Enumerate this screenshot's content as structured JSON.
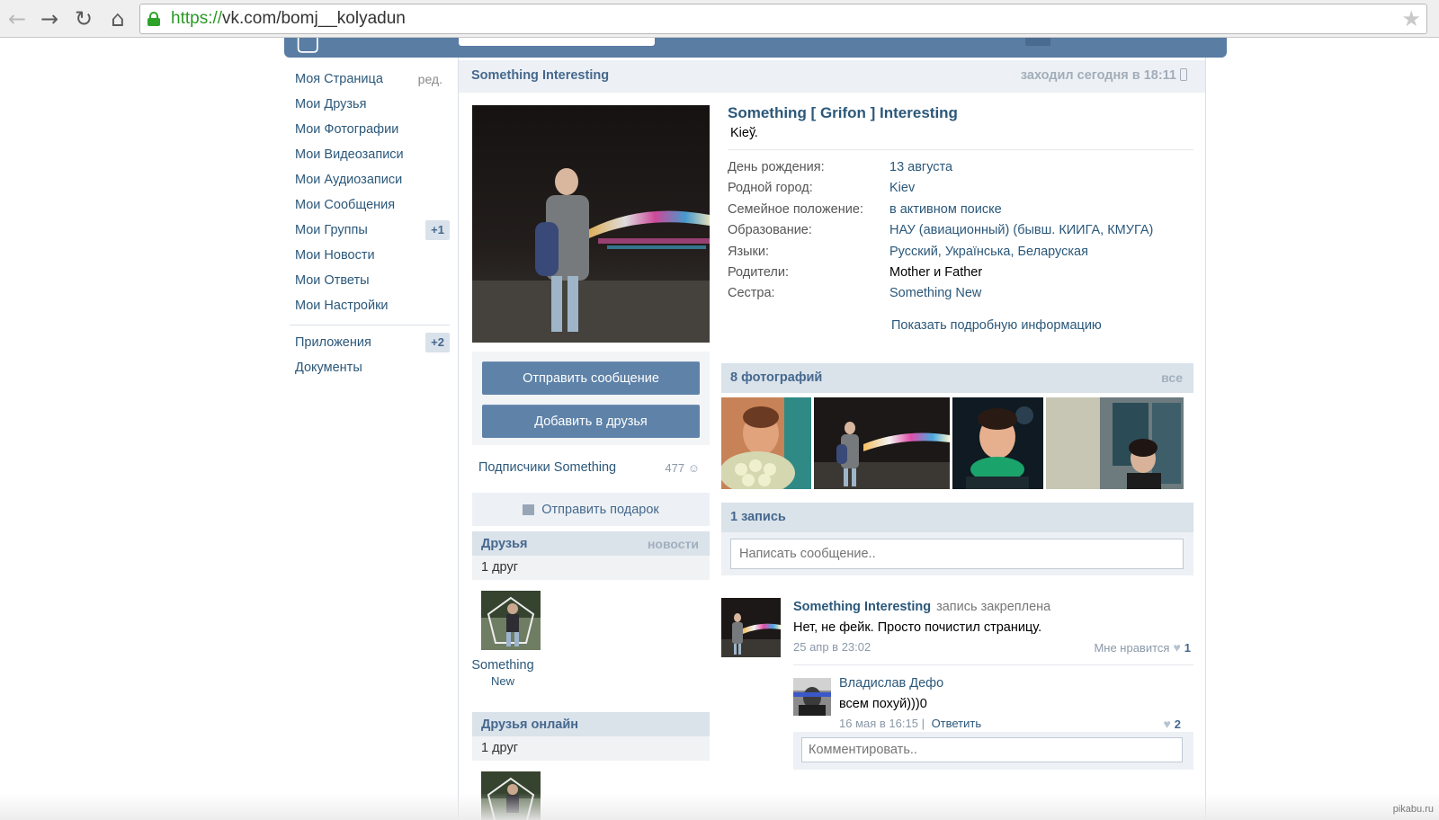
{
  "browser": {
    "url_scheme": "https://",
    "url_rest": "vk.com/bomj__kolyadun",
    "icons": [
      "back-arrow-icon",
      "forward-arrow-icon",
      "reload-icon",
      "home-icon",
      "lock-icon",
      "star-icon"
    ]
  },
  "sidebar": {
    "edit_label": "ред.",
    "items": [
      {
        "label": "Моя Страница"
      },
      {
        "label": "Мои Друзья"
      },
      {
        "label": "Мои Фотографии"
      },
      {
        "label": "Мои Видеозаписи"
      },
      {
        "label": "Мои Аудиозаписи"
      },
      {
        "label": "Мои Сообщения"
      },
      {
        "label": "Мои Группы",
        "badge": "+1"
      },
      {
        "label": "Мои Новости"
      },
      {
        "label": "Мои Ответы"
      },
      {
        "label": "Мои Настройки"
      }
    ],
    "extra": [
      {
        "label": "Приложения",
        "badge": "+2"
      },
      {
        "label": "Документы"
      }
    ]
  },
  "profile": {
    "header_name": "Something Interesting",
    "last_seen": "заходил сегодня в 18:11",
    "full_name": "Something [ Grifon ] Interesting",
    "status": "Kieў.",
    "info": [
      {
        "label": "День рождения:",
        "value": "13 августа"
      },
      {
        "label": "Родной город:",
        "value": "Kiev"
      },
      {
        "label": "Семейное положение:",
        "value": "в активном поиске"
      },
      {
        "label": "Образование:",
        "value": "НАУ (авиационный) (бывш. КИИГА, КМУГА)"
      },
      {
        "label": "Языки:",
        "value": "Русский, Українська, Беларуская"
      },
      {
        "label": "Родители:",
        "value": "Mother и Father"
      },
      {
        "label": "Сестра:",
        "value": "Something New"
      }
    ],
    "more_info": "Показать подробную информацию"
  },
  "actions": {
    "send_message": "Отправить сообщение",
    "add_friend": "Добавить в друзья",
    "subscribers_label": "Подписчики Something",
    "subscribers_count": "477",
    "gift": "Отправить подарок"
  },
  "friends": {
    "title": "Друзья",
    "link": "новости",
    "count": "1 друг",
    "friend_first": "Something",
    "friend_last": "New"
  },
  "friends_online": {
    "title": "Друзья онлайн",
    "count": "1 друг"
  },
  "photos": {
    "title": "8 фотографий",
    "link": "все"
  },
  "wall": {
    "title": "1 запись",
    "placeholder": "Написать сообщение..",
    "post": {
      "author": "Something Interesting",
      "pinned": "запись закреплена",
      "text": "Нет, не фейк. Просто почистил страницу.",
      "date": "25 апр в 23:02",
      "like_label": "Мне нравится",
      "likes": "1"
    },
    "comment": {
      "author": "Владислав Дефо",
      "text": "всем похуй)))0",
      "date": "16 мая в 16:15",
      "reply": "Ответить",
      "likes": "2"
    },
    "comment_placeholder": "Комментировать.."
  },
  "watermark": "pikabu.ru"
}
